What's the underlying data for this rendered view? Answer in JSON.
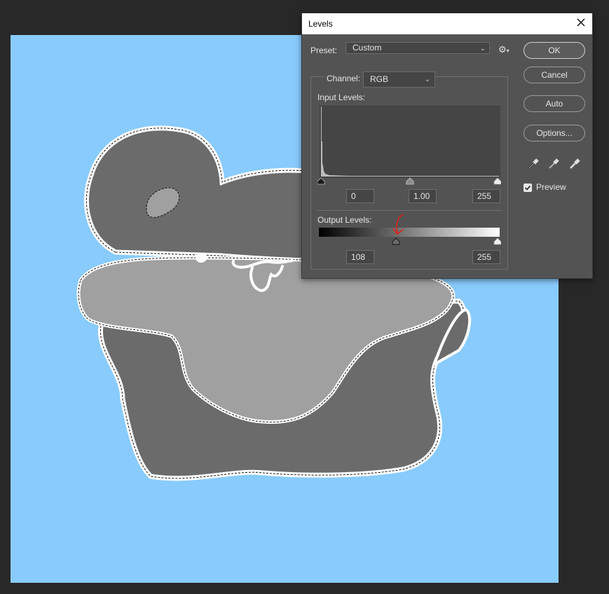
{
  "dialog": {
    "title": "Levels",
    "preset_label": "Preset:",
    "preset_value": "Custom",
    "channel_label": "Channel:",
    "channel_value": "RGB",
    "input_levels_label": "Input Levels:",
    "input_black": "0",
    "input_gamma": "1.00",
    "input_white": "255",
    "output_levels_label": "Output Levels:",
    "output_black": "108",
    "output_white": "255",
    "buttons": {
      "ok": "OK",
      "cancel": "Cancel",
      "auto": "Auto",
      "options": "Options..."
    },
    "preview_label": "Preview",
    "preview_checked": true
  },
  "colors": {
    "canvas_background": "#88cbfc",
    "dialog_bg": "#535353",
    "annotation_arrow": "#e0211c"
  },
  "icons": [
    "close-icon",
    "gear-icon",
    "eyedropper-black-icon",
    "eyedropper-gray-icon",
    "eyedropper-white-icon",
    "checkmark-icon"
  ]
}
